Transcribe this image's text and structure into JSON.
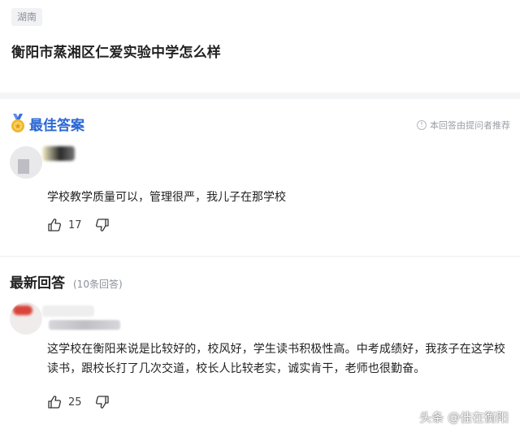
{
  "question": {
    "tag": "湖南",
    "title": "衡阳市蒸湘区仁爱实验中学怎么样"
  },
  "best_answer": {
    "heading": "最佳答案",
    "asker_note": "本回答由提问者推荐",
    "text": "学校教学质量可以，管理很严，我儿子在那学校",
    "likes": "17",
    "icons": {
      "medal": "medal-icon",
      "like": "thumbs-up-icon",
      "dislike": "thumbs-down-icon",
      "info": "info-icon"
    }
  },
  "recent": {
    "heading": "最新回答",
    "count": "(10条回答)",
    "answer": {
      "text": "这学校在衡阳来说是比较好的，校风好，学生读书积极性高。中考成绩好，我孩子在这学校读书，跟校长打了几次交道，校长人比较老实，诚实肯干，老师也很勤奋。",
      "likes": "25"
    }
  },
  "watermark": "头条 @佳在衡阳",
  "colors": {
    "accent": "#2a66d4",
    "medal_gold": "#f0b429"
  }
}
